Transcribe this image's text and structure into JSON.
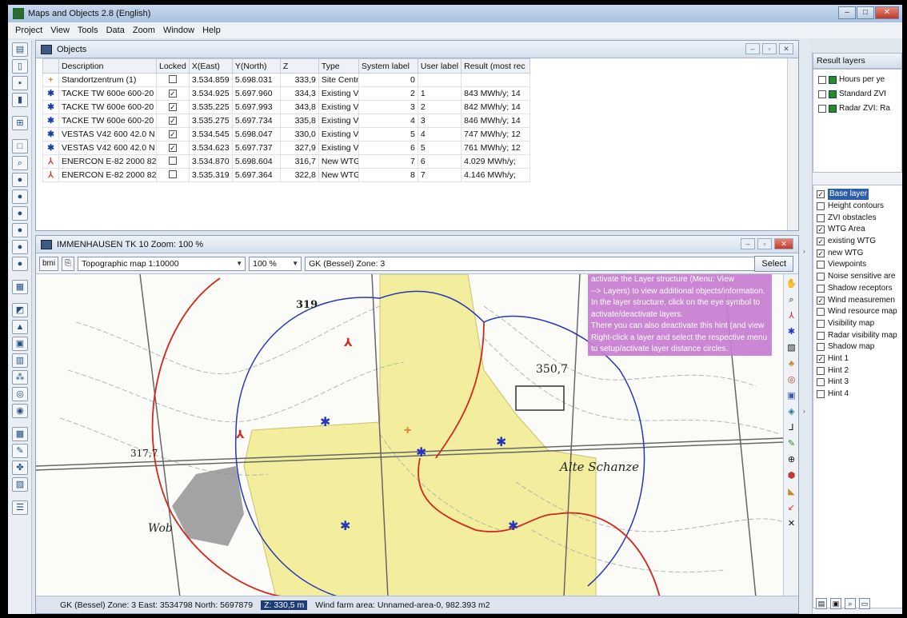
{
  "window": {
    "title": "Maps and Objects 2.8 (English)"
  },
  "menu": [
    "Project",
    "View",
    "Tools",
    "Data",
    "Zoom",
    "Window",
    "Help"
  ],
  "objects_panel": {
    "title": "Objects",
    "columns": [
      "Description",
      "Locked",
      "X(East)",
      "Y(North)",
      "Z",
      "Type",
      "System label",
      "User label",
      "Result (most rec"
    ],
    "rows": [
      {
        "icon": "+",
        "desc": "Standortzentrum (1)",
        "locked": "",
        "x": "3.534.859",
        "y": "5.698.031",
        "z": "333,9",
        "type": "Site Centr",
        "sys": "0",
        "user": "",
        "result": ""
      },
      {
        "icon": "✱",
        "desc": "TACKE TW 600e 600-20",
        "locked": "✓",
        "x": "3.534.925",
        "y": "5.697.960",
        "z": "334,3",
        "type": "Existing V",
        "sys": "2",
        "user": "1",
        "result": "843 MWh/y;  14"
      },
      {
        "icon": "✱",
        "desc": "TACKE TW 600e 600-20",
        "locked": "✓",
        "x": "3.535.225",
        "y": "5.697.993",
        "z": "343,8",
        "type": "Existing V",
        "sys": "3",
        "user": "2",
        "result": "842 MWh/y;  14"
      },
      {
        "icon": "✱",
        "desc": "TACKE TW 600e 600-20",
        "locked": "✓",
        "x": "3.535.275",
        "y": "5.697.734",
        "z": "335,8",
        "type": "Existing V",
        "sys": "4",
        "user": "3",
        "result": "846 MWh/y;  14"
      },
      {
        "icon": "✱",
        "desc": "VESTAS V42 600 42.0 N",
        "locked": "✓",
        "x": "3.534.545",
        "y": "5.698.047",
        "z": "330,0",
        "type": "Existing V",
        "sys": "5",
        "user": "4",
        "result": "747 MWh/y;  12"
      },
      {
        "icon": "✱",
        "desc": "VESTAS V42 600 42.0 N",
        "locked": "✓",
        "x": "3.534.623",
        "y": "5.697.737",
        "z": "327,9",
        "type": "Existing V",
        "sys": "6",
        "user": "5",
        "result": "761 MWh/y;  12"
      },
      {
        "icon": "⅄",
        "desc": "ENERCON E-82 2000 82",
        "locked": "",
        "x": "3.534.870",
        "y": "5.698.604",
        "z": "316,7",
        "type": "New WTG",
        "sys": "7",
        "user": "6",
        "result": "4.029 MWh/y;"
      },
      {
        "icon": "⅄",
        "desc": "ENERCON E-82 2000 82",
        "locked": "",
        "x": "3.535.319",
        "y": "5.697.364",
        "z": "322,8",
        "type": "New WTG",
        "sys": "8",
        "user": "7",
        "result": "4.146 MWh/y;"
      }
    ]
  },
  "map_window": {
    "title": "IMMENHAUSEN TK 10 Zoom: 100 %",
    "bmp_label": "bmi",
    "map_select": "Topographic map 1:10000",
    "zoom_select": "100 %",
    "projection_select": "GK (Bessel) Zone: 3",
    "select_button": "Select",
    "map_labels": {
      "elev_319": "319",
      "elev_350": "350,7",
      "elev_317": "317,7",
      "place": "Alte Schanze",
      "wob": "Wob"
    },
    "hint_lines": [
      "activate the Layer structure (Menu: View",
      "--> Layers) to view additional objects/information.",
      "In the layer structure, click on the eye symbol to",
      "activate/deactivate layers.",
      "There you can also deactivate this hint (and view",
      "Right-click a layer and select the respective menu",
      "to setup/activate layer distance circles."
    ],
    "status": {
      "coords": "GK (Bessel) Zone: 3  East: 3534798  North: 5697879",
      "z": "Z: 330,5 m",
      "wind_area": "Wind farm area: Unnamed-area-0, 982.393 m2"
    }
  },
  "result_layers": {
    "title": "Result layers",
    "items": [
      "Hours per ye",
      "Standard ZVI",
      "Radar ZVI: Ra"
    ]
  },
  "layers": [
    {
      "label": "Base layer",
      "checked": true,
      "selected": true
    },
    {
      "label": "Height contours",
      "checked": false
    },
    {
      "label": "ZVI obstacles",
      "checked": false
    },
    {
      "label": "WTG Area",
      "checked": true
    },
    {
      "label": "existing WTG",
      "checked": true
    },
    {
      "label": "new WTG",
      "checked": true
    },
    {
      "label": "Viewpoints",
      "checked": false
    },
    {
      "label": "Noise sensitive are",
      "checked": false
    },
    {
      "label": "Shadow receptors",
      "checked": false
    },
    {
      "label": "Wind measuremen",
      "checked": true
    },
    {
      "label": "Wind resource map",
      "checked": false
    },
    {
      "label": "Visibility map",
      "checked": false
    },
    {
      "label": "Radar visibility map",
      "checked": false
    },
    {
      "label": "Shadow map",
      "checked": false
    },
    {
      "label": "Hint 1",
      "checked": true
    },
    {
      "label": "Hint 2",
      "checked": false
    },
    {
      "label": "Hint 3",
      "checked": false
    },
    {
      "label": "Hint 4",
      "checked": false
    }
  ],
  "colors": {
    "accent": "#2f5ea8",
    "hint_bg": "#c77ed0",
    "area_fill": "#f3ee9e",
    "red_curve": "#d3271e",
    "blue_curve": "#2736b8"
  }
}
